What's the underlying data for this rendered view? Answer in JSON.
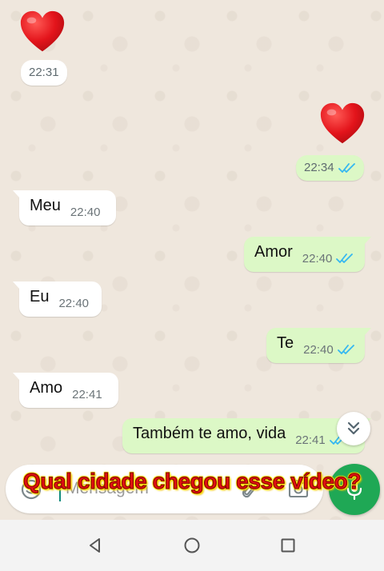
{
  "messages": [
    {
      "type": "emoji",
      "direction": "in",
      "emoji": "red-heart",
      "time": "22:31"
    },
    {
      "type": "emoji",
      "direction": "out",
      "emoji": "red-heart",
      "time": "22:34",
      "status": "read"
    },
    {
      "type": "text",
      "direction": "in",
      "text": "Meu",
      "time": "22:40"
    },
    {
      "type": "text",
      "direction": "out",
      "text": "Amor",
      "time": "22:40",
      "status": "read"
    },
    {
      "type": "text",
      "direction": "in",
      "text": "Eu",
      "time": "22:40"
    },
    {
      "type": "text",
      "direction": "out",
      "text": "Te",
      "time": "22:40",
      "status": "read"
    },
    {
      "type": "text",
      "direction": "in",
      "text": "Amo",
      "time": "22:41"
    },
    {
      "type": "text",
      "direction": "out",
      "text": "Também te amo, vida",
      "time": "22:41",
      "status": "read"
    }
  ],
  "composer": {
    "placeholder": "Mensagem",
    "icons": [
      "emoji-icon",
      "paperclip-icon",
      "camera-icon",
      "mic-icon"
    ]
  },
  "scroll_button": {
    "icon": "double-chevron-down-icon"
  },
  "overlay_caption": "Qual cidade chegou esse vídeo?",
  "navbar": {
    "icons": [
      "back-triangle-icon",
      "home-circle-icon",
      "recents-square-icon"
    ]
  },
  "colors": {
    "background": "#efe7dd",
    "incoming": "#ffffff",
    "outgoing": "#dcf8c6",
    "read_ticks": "#34b7f1",
    "accent": "#1fa855",
    "caption": "#e01010",
    "caption_glow": "#ffe800"
  }
}
